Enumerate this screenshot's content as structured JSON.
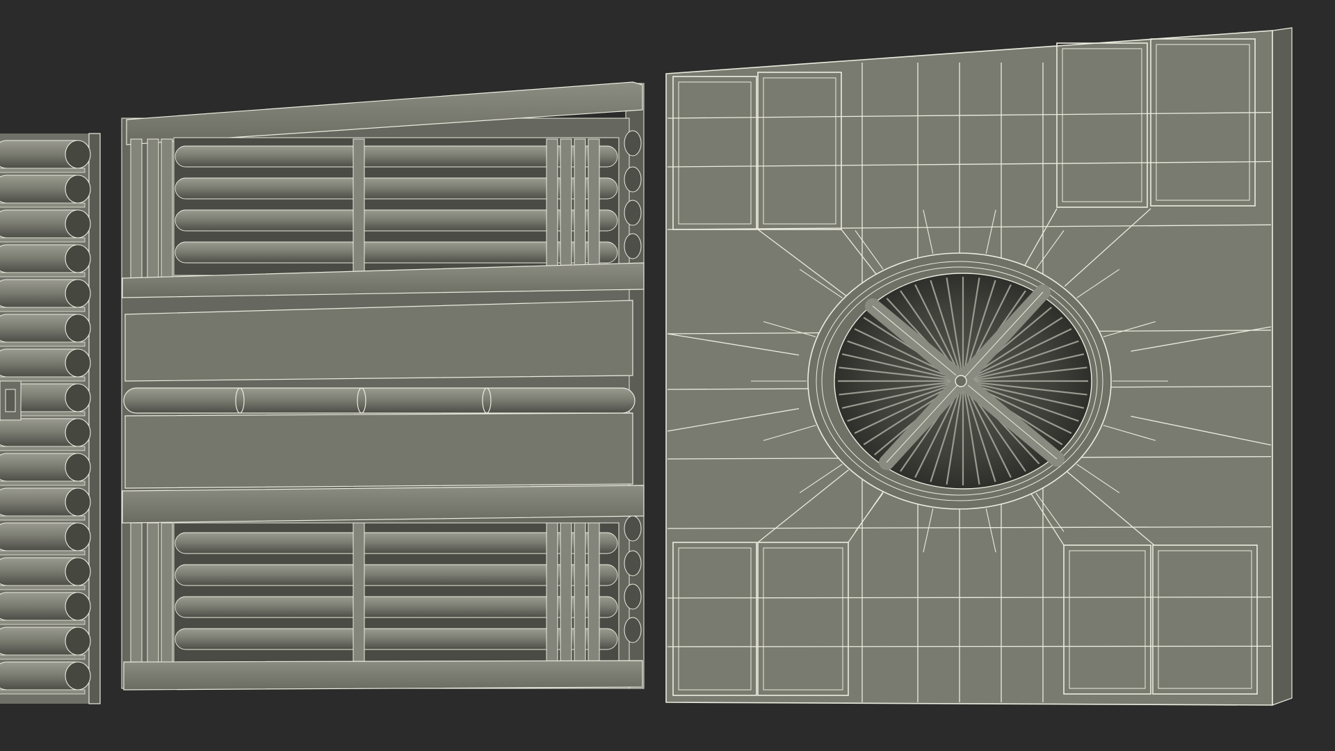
{
  "scene": {
    "background": "#2b2b2b",
    "surface_color": "#7b7c71",
    "surface_light": "#8a8b80",
    "surface_dark": "#56574f",
    "shadow_color": "#3b3c36",
    "wire_color": "#ecece0",
    "panels": [
      {
        "name": "left-tube-panel",
        "kind": "tube-rack"
      },
      {
        "name": "middle-pipe-panel",
        "kind": "pipe-frame"
      },
      {
        "name": "right-fan-panel",
        "kind": "fan-vent-wireframe"
      }
    ]
  }
}
